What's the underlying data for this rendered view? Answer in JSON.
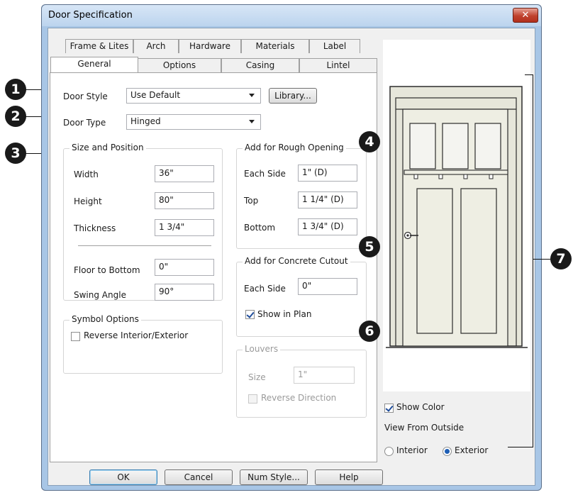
{
  "window": {
    "title": "Door Specification",
    "close_glyph": "✕"
  },
  "tabs_back": [
    "Frame & Lites",
    "Arch",
    "Hardware",
    "Materials",
    "Label"
  ],
  "tabs_front": [
    "General",
    "Options",
    "Casing",
    "Lintel"
  ],
  "active_tab": "General",
  "general": {
    "door_style_label": "Door Style",
    "door_style_value": "Use Default",
    "library_button": "Library...",
    "door_type_label": "Door Type",
    "door_type_value": "Hinged"
  },
  "size_position": {
    "title": "Size and Position",
    "width_label": "Width",
    "width_value": "36\"",
    "height_label": "Height",
    "height_value": "80\"",
    "thickness_label": "Thickness",
    "thickness_value": "1 3/4\"",
    "floor_label": "Floor to Bottom",
    "floor_value": "0\"",
    "swing_label": "Swing Angle",
    "swing_value": "90°"
  },
  "rough_opening": {
    "title": "Add for Rough Opening",
    "each_side_label": "Each Side",
    "each_side_value": "1\" (D)",
    "top_label": "Top",
    "top_value": "1 1/4\" (D)",
    "bottom_label": "Bottom",
    "bottom_value": "1 3/4\" (D)"
  },
  "concrete_cutout": {
    "title": "Add for Concrete Cutout",
    "each_side_label": "Each Side",
    "each_side_value": "0\"",
    "show_in_plan_label": "Show in Plan",
    "show_in_plan_checked": true
  },
  "symbol_options": {
    "title": "Symbol Options",
    "reverse_label": "Reverse Interior/Exterior",
    "reverse_checked": false
  },
  "louvers": {
    "title": "Louvers",
    "size_label": "Size",
    "size_value": "1\"",
    "reverse_label": "Reverse Direction",
    "reverse_checked": false
  },
  "preview": {
    "show_color_label": "Show Color",
    "show_color_checked": true,
    "view_from_label": "View From Outside",
    "interior_label": "Interior",
    "exterior_label": "Exterior",
    "selected_view": "Exterior"
  },
  "buttons": {
    "ok": "OK",
    "cancel": "Cancel",
    "num_style": "Num Style...",
    "help": "Help"
  },
  "callouts": [
    "1",
    "2",
    "3",
    "4",
    "5",
    "6",
    "7"
  ],
  "colors": {
    "callout": "#1a1a1a",
    "door": "#eeeee3",
    "frame": "#e6e6da"
  }
}
